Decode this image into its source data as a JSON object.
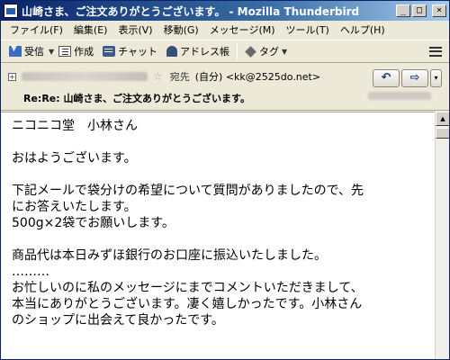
{
  "window": {
    "title": "山崎さま、ご注文ありがとうございます。 - Mozilla Thunderbird",
    "controls": {
      "minimize": "_",
      "maximize": "□",
      "close": "×"
    }
  },
  "menubar": {
    "items": [
      "ファイル(F)",
      "編集(E)",
      "表示(V)",
      "移動(G)",
      "メッセージ(M)",
      "ツール(T)",
      "ヘルプ(H)"
    ]
  },
  "toolbar": {
    "get": "受信",
    "write": "作成",
    "chat": "チャット",
    "address_book": "アドレス帳",
    "tag": "タグ"
  },
  "header": {
    "to_label": "宛先",
    "to_value": "(自分) <kk@2525do.net>",
    "subject": "Re:Re: 山崎さま、ご注文ありがとうございます。",
    "nav": {
      "reply": "↶",
      "forward": "⇨",
      "more": "▾"
    }
  },
  "body": {
    "lines": [
      "ニコニコ堂　小林さん",
      "",
      "おはようございます。",
      "",
      "下記メールで袋分けの希望について質問がありましたので、先",
      "にお答えいたします。",
      "500g×2袋でお願いします。",
      "",
      "商品代は本日みずほ銀行のお口座に振込いたしました。",
      "………",
      "お忙しいのに私のメッセージにまでコメントいただきまして、",
      "本当にありがとうございます。凄く嬉しかったです。小林さん",
      "のショップに出会えて良かったです。"
    ]
  }
}
